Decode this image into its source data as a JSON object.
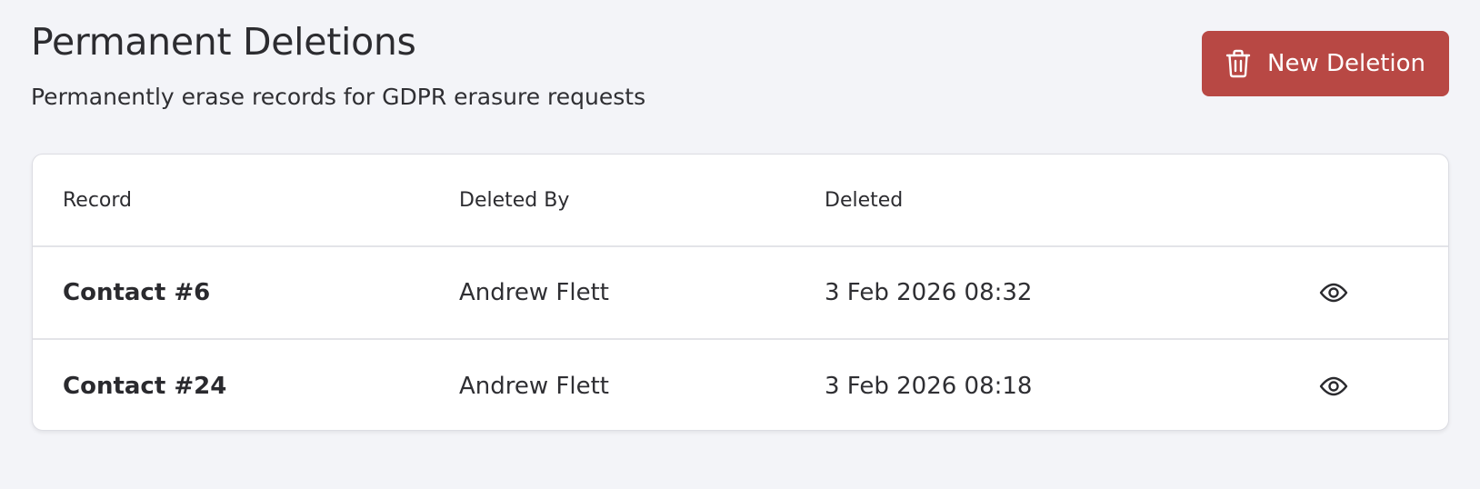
{
  "header": {
    "title": "Permanent Deletions",
    "subtitle": "Permanently erase records for GDPR erasure requests",
    "new_button_label": "New Deletion",
    "new_button_icon": "trash-icon"
  },
  "table": {
    "columns": [
      "Record",
      "Deleted By",
      "Deleted",
      ""
    ],
    "rows": [
      {
        "record": "Contact #6",
        "deleted_by": "Andrew Flett",
        "deleted": "3 Feb 2026 08:32",
        "action_icon": "eye-icon"
      },
      {
        "record": "Contact #24",
        "deleted_by": "Andrew Flett",
        "deleted": "3 Feb 2026 08:18",
        "action_icon": "eye-icon"
      }
    ]
  },
  "colors": {
    "background": "#f3f4f8",
    "danger": "#b84844",
    "card": "#ffffff",
    "border": "#e3e4e8"
  }
}
